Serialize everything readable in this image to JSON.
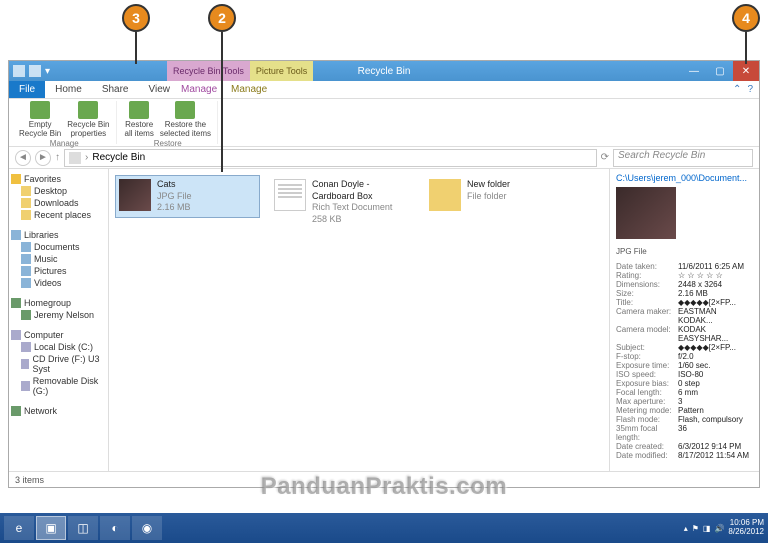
{
  "callouts": {
    "c2": "2",
    "c3": "3",
    "c4": "4"
  },
  "titlebar": {
    "ctx1": "Recycle Bin Tools",
    "ctx2": "Picture Tools",
    "title": "Recycle Bin"
  },
  "tabs": {
    "file": "File",
    "home": "Home",
    "share": "Share",
    "view": "View",
    "manage1": "Manage",
    "manage2": "Manage"
  },
  "ribbon": {
    "empty": "Empty\nRecycle Bin",
    "props": "Recycle Bin\nproperties",
    "restore_all": "Restore\nall items",
    "restore_sel": "Restore the\nselected items",
    "grp_manage": "Manage",
    "grp_restore": "Restore"
  },
  "address": {
    "path": "Recycle Bin",
    "search_placeholder": "Search Recycle Bin"
  },
  "sidebar": {
    "favorites": "Favorites",
    "desktop": "Desktop",
    "downloads": "Downloads",
    "recent": "Recent places",
    "libraries": "Libraries",
    "documents": "Documents",
    "music": "Music",
    "pictures": "Pictures",
    "videos": "Videos",
    "homegroup": "Homegroup",
    "hg_user": "Jeremy Nelson",
    "computer": "Computer",
    "local": "Local Disk (C:)",
    "cd": "CD Drive (F:) U3 Syst",
    "removable": "Removable Disk (G:)",
    "network": "Network"
  },
  "files": {
    "f1": {
      "name": "Cats",
      "type": "JPG File",
      "size": "2.16 MB"
    },
    "f2": {
      "name": "Conan Doyle - Cardboard Box",
      "type": "Rich Text Document",
      "size": "258 KB"
    },
    "f3": {
      "name": "New folder",
      "type": "File folder"
    }
  },
  "details": {
    "path": "C:\\Users\\jerem_000\\Document...",
    "type": "JPG File",
    "rows": [
      {
        "k": "Date taken:",
        "v": "11/6/2011 6:25 AM"
      },
      {
        "k": "Rating:",
        "v": "☆ ☆ ☆ ☆ ☆"
      },
      {
        "k": "Dimensions:",
        "v": "2448 x 3264"
      },
      {
        "k": "Size:",
        "v": "2.16 MB"
      },
      {
        "k": "Title:",
        "v": "◆◆◆◆◆[2×FP..."
      },
      {
        "k": "Camera maker:",
        "v": "EASTMAN KODAK..."
      },
      {
        "k": "Camera model:",
        "v": "KODAK EASYSHAR..."
      },
      {
        "k": "Subject:",
        "v": "◆◆◆◆◆[2×FP..."
      },
      {
        "k": "F-stop:",
        "v": "f/2.0"
      },
      {
        "k": "Exposure time:",
        "v": "1/60 sec."
      },
      {
        "k": "ISO speed:",
        "v": "ISO-80"
      },
      {
        "k": "Exposure bias:",
        "v": "0 step"
      },
      {
        "k": "Focal length:",
        "v": "6 mm"
      },
      {
        "k": "Max aperture:",
        "v": "3"
      },
      {
        "k": "Metering mode:",
        "v": "Pattern"
      },
      {
        "k": "Flash mode:",
        "v": "Flash, compulsory"
      },
      {
        "k": "35mm focal length:",
        "v": "36"
      },
      {
        "k": "Date created:",
        "v": "6/3/2012 9:14 PM"
      },
      {
        "k": "Date modified:",
        "v": "8/17/2012 11:54 AM"
      }
    ]
  },
  "status": {
    "count": "3 items"
  },
  "taskbar": {
    "time": "10:06 PM",
    "date": "8/26/2012"
  },
  "watermark": "PanduanPraktis.com"
}
